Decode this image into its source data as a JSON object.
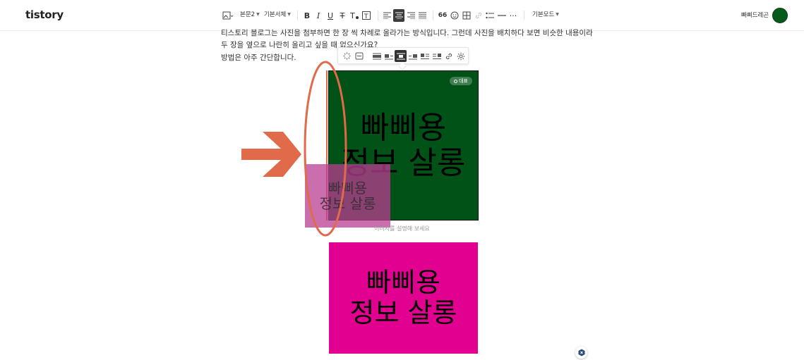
{
  "app": {
    "logo": "tistory"
  },
  "toolbar": {
    "paragraph_style": "본문2",
    "font_family": "기본서체",
    "quote_label": "66",
    "mode": "기본모드",
    "blog_name": "빠삐드레곤"
  },
  "content": {
    "lines": [
      "티스토리 블로그는 사진을 첨부하면 한 장 씩 차례로 올라가는 방식입니다. 그런데 사진을 배치하다 보면 비슷한 내용이라",
      "두 장을 옆으로 나란히 올리고 싶을 때 없으신가요?",
      "방법은 아주 간단합니다."
    ]
  },
  "images": {
    "green": {
      "line1": "빠삐용",
      "line2": "정보 살롱",
      "color": "#005217"
    },
    "pink": {
      "line1": "빠삐용",
      "line2": "정보 살롱",
      "color": "#e1008f"
    },
    "ghost": {
      "line1": "빠삐용",
      "line2": "정보 살롱"
    },
    "rep_badge": "대표",
    "caption_placeholder": "이미지를 설명해 보세요"
  },
  "annotation": {
    "arrow_color": "#e06a4a"
  }
}
